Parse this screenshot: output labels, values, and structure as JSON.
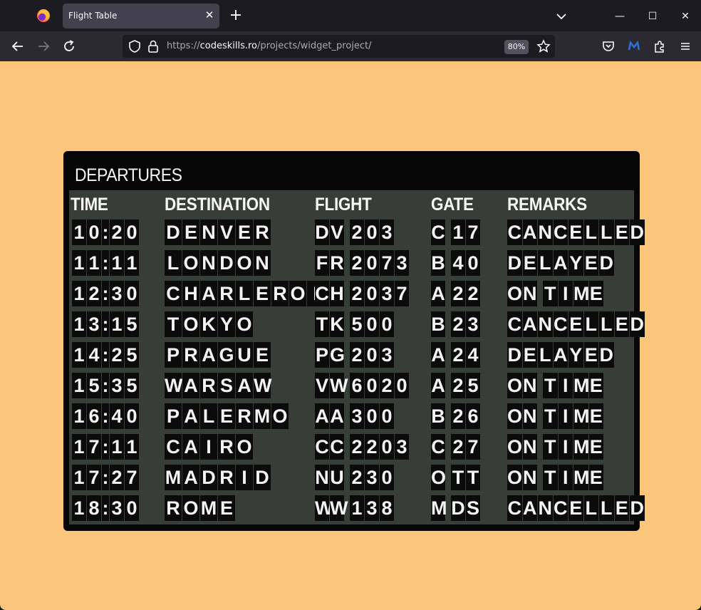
{
  "browser": {
    "tab_title": "Flight Table",
    "url_scheme": "https://",
    "url_domain": "codeskills.ro",
    "url_path": "/projects/widget_project/",
    "zoom": "80%"
  },
  "board": {
    "title": "DEPARTURES",
    "columns": {
      "time": "TIME",
      "destination": "DESTINATION",
      "flight": "FLIGHT",
      "gate": "GATE",
      "remarks": "REMARKS"
    },
    "rows": [
      {
        "time": "10:20",
        "destination": "DENVER",
        "flight": "DV 203",
        "gate": "C 17",
        "remarks": "CANCELLED"
      },
      {
        "time": "11:11",
        "destination": "LONDON",
        "flight": "FR 2073",
        "gate": "B 40",
        "remarks": "DELAYED"
      },
      {
        "time": "12:30",
        "destination": "CHARLEROI",
        "flight": "CH 2037",
        "gate": "A 22",
        "remarks": "ON TIME"
      },
      {
        "time": "13:15",
        "destination": "TOKYO",
        "flight": "TK 500",
        "gate": "B 23",
        "remarks": "CANCELLED"
      },
      {
        "time": "14:25",
        "destination": "PRAGUE",
        "flight": "PG 203",
        "gate": "A 24",
        "remarks": "DELAYED"
      },
      {
        "time": "15:35",
        "destination": "WARSAW",
        "flight": "VW 6020",
        "gate": "A 25",
        "remarks": "ON TIME"
      },
      {
        "time": "16:40",
        "destination": "PALERMO",
        "flight": "AA 300",
        "gate": "B 26",
        "remarks": "ON TIME"
      },
      {
        "time": "17:11",
        "destination": "CAIRO",
        "flight": "CC 2203",
        "gate": "C 27",
        "remarks": "ON TIME"
      },
      {
        "time": "17:27",
        "destination": "MADRID",
        "flight": "NU 230",
        "gate": "O TT",
        "remarks": "ON TIME"
      },
      {
        "time": "18:30",
        "destination": "ROME",
        "flight": "WW 138",
        "gate": "M DS",
        "remarks": "CANCELLED"
      }
    ]
  }
}
